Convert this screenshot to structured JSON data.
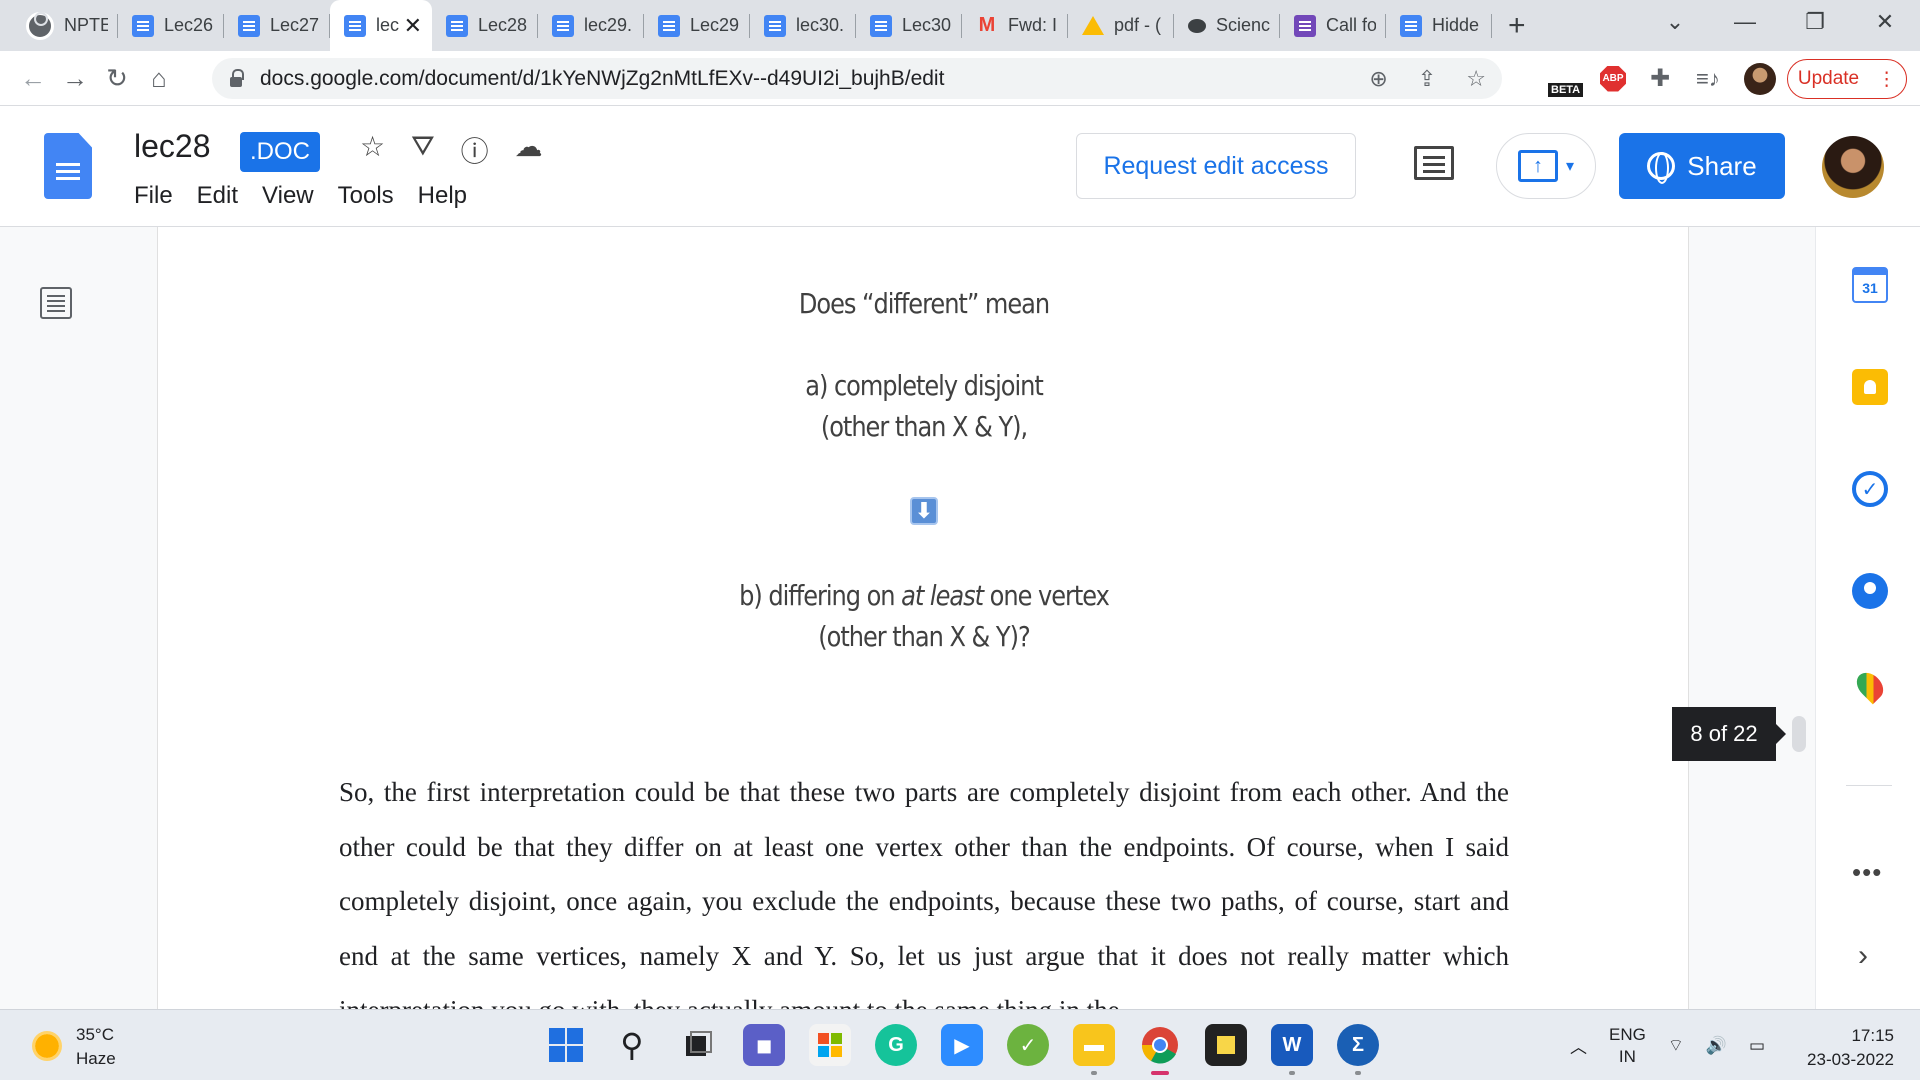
{
  "browser": {
    "tabs": [
      {
        "label": "NPTEL",
        "icon": "globe-icon"
      },
      {
        "label": "Lec26",
        "icon": "docs-icon"
      },
      {
        "label": "Lec27",
        "icon": "docs-icon"
      },
      {
        "label": "lec",
        "icon": "docs-icon",
        "active": true
      },
      {
        "label": "Lec28",
        "icon": "docs-icon"
      },
      {
        "label": "lec29.",
        "icon": "docs-icon"
      },
      {
        "label": "Lec29",
        "icon": "docs-icon"
      },
      {
        "label": "lec30.",
        "icon": "docs-icon"
      },
      {
        "label": "Lec30",
        "icon": "docs-icon"
      },
      {
        "label": "Fwd: I",
        "icon": "gmail-icon"
      },
      {
        "label": "pdf - (",
        "icon": "drive-icon"
      },
      {
        "label": "Scienc",
        "icon": "chat-icon"
      },
      {
        "label": "Call fo",
        "icon": "forms-icon"
      },
      {
        "label": "Hidde",
        "icon": "docs-icon"
      }
    ],
    "url": "docs.google.com/document/d/1kYeNWjZg2nMtLfEXv--d49UI2i_bujhB/edit",
    "beta_label": "BETA",
    "abp_label": "ABP",
    "update_label": "Update"
  },
  "docs": {
    "title": "lec28",
    "badge": ".DOC",
    "menu": [
      "File",
      "Edit",
      "View",
      "Tools",
      "Help"
    ],
    "request_edit": "Request edit access",
    "share": "Share"
  },
  "slide": {
    "line1": "Does “different” mean",
    "option_a_line1": "a) completely disjoint",
    "option_a_line2": "(other than X & Y),",
    "arrow": "⬇",
    "option_b_prefix": "b) differing on ",
    "option_b_emph": "at least",
    "option_b_suffix": " one vertex",
    "option_b_line2": "(other than X & Y)?"
  },
  "body_text": "So, the first interpretation could be that these two parts are completely disjoint from each other. And the other could be that they differ on at least one vertex other than the endpoints. Of course, when I said completely disjoint, once again, you exclude the endpoints, because these two paths, of course, start and end at the same vertices, namely X and Y. So, let us just argue that it does not really matter which interpretation you go with, they actually amount to the same thing in the",
  "page_indicator": "8 of 22",
  "side_panel": {
    "calendar_day": "31"
  },
  "taskbar": {
    "temperature": "35°C",
    "condition": "Haze",
    "lang1": "ENG",
    "lang2": "IN",
    "time": "17:15",
    "date": "23-03-2022"
  },
  "colors": {
    "accent": "#1a73e8",
    "update_red": "#d93025",
    "tab_strip": "#dee1e6"
  }
}
